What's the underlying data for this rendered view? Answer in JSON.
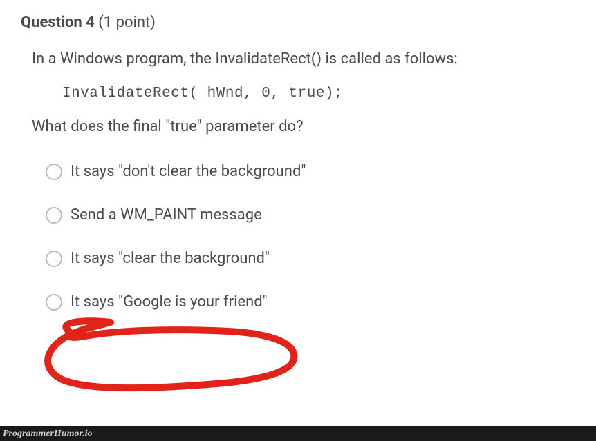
{
  "question": {
    "label_prefix": "Question",
    "number": "4",
    "points_text": "(1 point)",
    "prompt_line1": "In a Windows program, the InvalidateRect() is called as follows:",
    "code": "InvalidateRect( hWnd, 0, true);",
    "prompt_line2": "What does the final \"true\" parameter do?"
  },
  "options": [
    {
      "label": "It says \"don't clear the background\""
    },
    {
      "label": "Send a WM_PAINT message"
    },
    {
      "label": "It says \"clear the background\""
    },
    {
      "label": "It says \"Google is your friend\""
    }
  ],
  "watermark": "ProgrammerHumor.io"
}
